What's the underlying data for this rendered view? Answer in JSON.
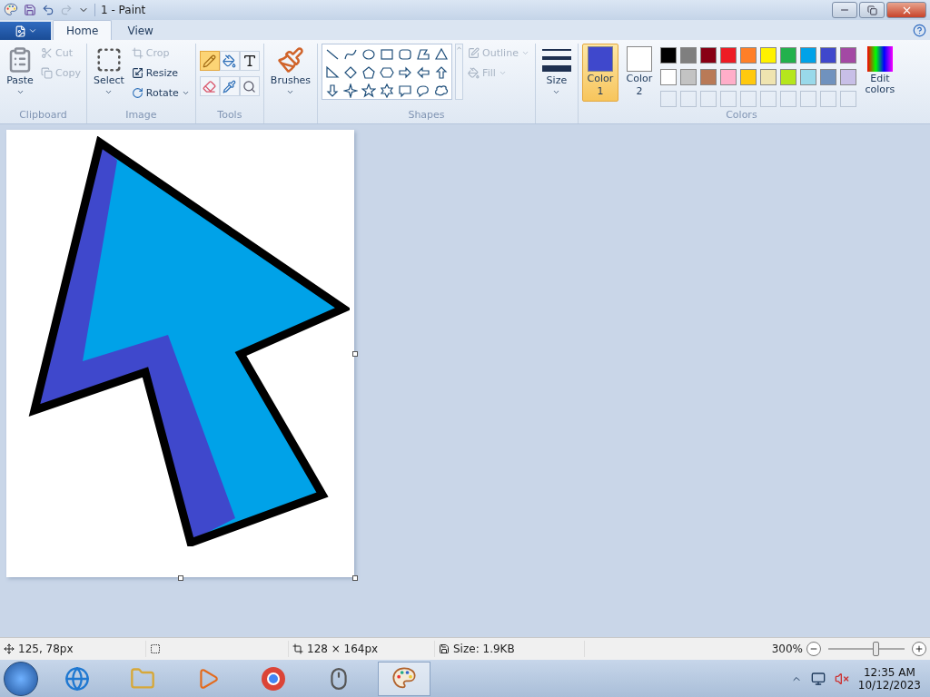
{
  "window": {
    "title": "1 - Paint"
  },
  "tabs": [
    {
      "label": "Home",
      "selected": true
    },
    {
      "label": "View",
      "selected": false
    }
  ],
  "clipboard": {
    "paste": "Paste",
    "cut": {
      "label": "Cut",
      "disabled": true
    },
    "copy": {
      "label": "Copy",
      "disabled": true
    },
    "group": "Clipboard"
  },
  "image": {
    "select": "Select",
    "crop": {
      "label": "Crop",
      "disabled": true
    },
    "resize": {
      "label": "Resize",
      "disabled": false
    },
    "rotate": {
      "label": "Rotate",
      "disabled": false
    },
    "group": "Image"
  },
  "tools": {
    "items": [
      {
        "kind": "pencil",
        "selected": true
      },
      {
        "kind": "fill",
        "selected": false
      },
      {
        "kind": "text",
        "selected": false
      },
      {
        "kind": "eraser",
        "selected": false
      },
      {
        "kind": "picker",
        "selected": false
      },
      {
        "kind": "magnifier",
        "selected": false
      }
    ],
    "group": "Tools"
  },
  "brushes": "Brushes",
  "shapes": {
    "outline": {
      "label": "Outline",
      "disabled": true
    },
    "fill": {
      "label": "Fill",
      "disabled": true
    },
    "group": "Shapes"
  },
  "size": "Size",
  "colors": {
    "slots": [
      {
        "label": "Color",
        "number": "1",
        "color": "#3f48cc",
        "selected": true
      },
      {
        "label": "Color",
        "number": "2",
        "color": "#ffffff",
        "selected": false
      }
    ],
    "palette": [
      {
        "color": "#000000"
      },
      {
        "color": "#7f7f7f"
      },
      {
        "color": "#880015"
      },
      {
        "color": "#ed1c24"
      },
      {
        "color": "#ff7f27"
      },
      {
        "color": "#fff200"
      },
      {
        "color": "#22b14c"
      },
      {
        "color": "#00a2e8"
      },
      {
        "color": "#3f48cc"
      },
      {
        "color": "#a349a4"
      },
      {
        "color": "#ffffff"
      },
      {
        "color": "#c3c3c3"
      },
      {
        "color": "#b97a57"
      },
      {
        "color": "#ffaec9"
      },
      {
        "color": "#ffc90e"
      },
      {
        "color": "#efe4b0"
      },
      {
        "color": "#b5e61d"
      },
      {
        "color": "#99d9ea"
      },
      {
        "color": "#7092be"
      },
      {
        "color": "#c8bfe7"
      }
    ],
    "edit": "Edit colors",
    "group": "Colors"
  },
  "status_bar": {
    "cursor": "125, 78px",
    "dimensions": "128 × 164px",
    "file_size": "Size: 1.9KB",
    "zoom": "300%",
    "zoom_slider": {
      "level": 0.63
    }
  },
  "taskbar": {
    "time": "12:35 AM",
    "date": "10/12/2023"
  }
}
